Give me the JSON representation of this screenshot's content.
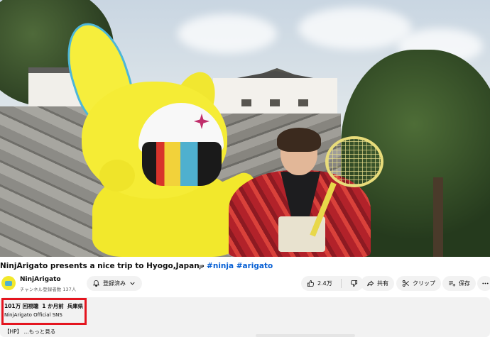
{
  "video": {
    "description": ""
  },
  "title": {
    "text": "NinjArigato presents a nice trip to Hyogo,Japan",
    "jp_badge": "JP",
    "hashtags": [
      "#ninja",
      "#arigato"
    ]
  },
  "channel": {
    "name": "NinjArigato",
    "subscribers": "チャンネル登録者数 137人",
    "avatar_icon": "mascot-avatar"
  },
  "actions": {
    "subscribed_label": "登録済み",
    "like_count": "2.4万",
    "share_label": "共有",
    "clip_label": "クリップ",
    "save_label": "保存",
    "more_icon": "more-horizontal-icon"
  },
  "description": {
    "views": "101万 回視聴",
    "date": "1 か月前",
    "location": "兵庫県",
    "line1": "NinjArigato Official SNS",
    "line2_prefix": "【HP】",
    "more_label": "...もっと見る"
  },
  "colors": {
    "highlight_box": "#e4151f",
    "hashtag": "#065fd4",
    "pill_bg": "#f2f2f2"
  }
}
